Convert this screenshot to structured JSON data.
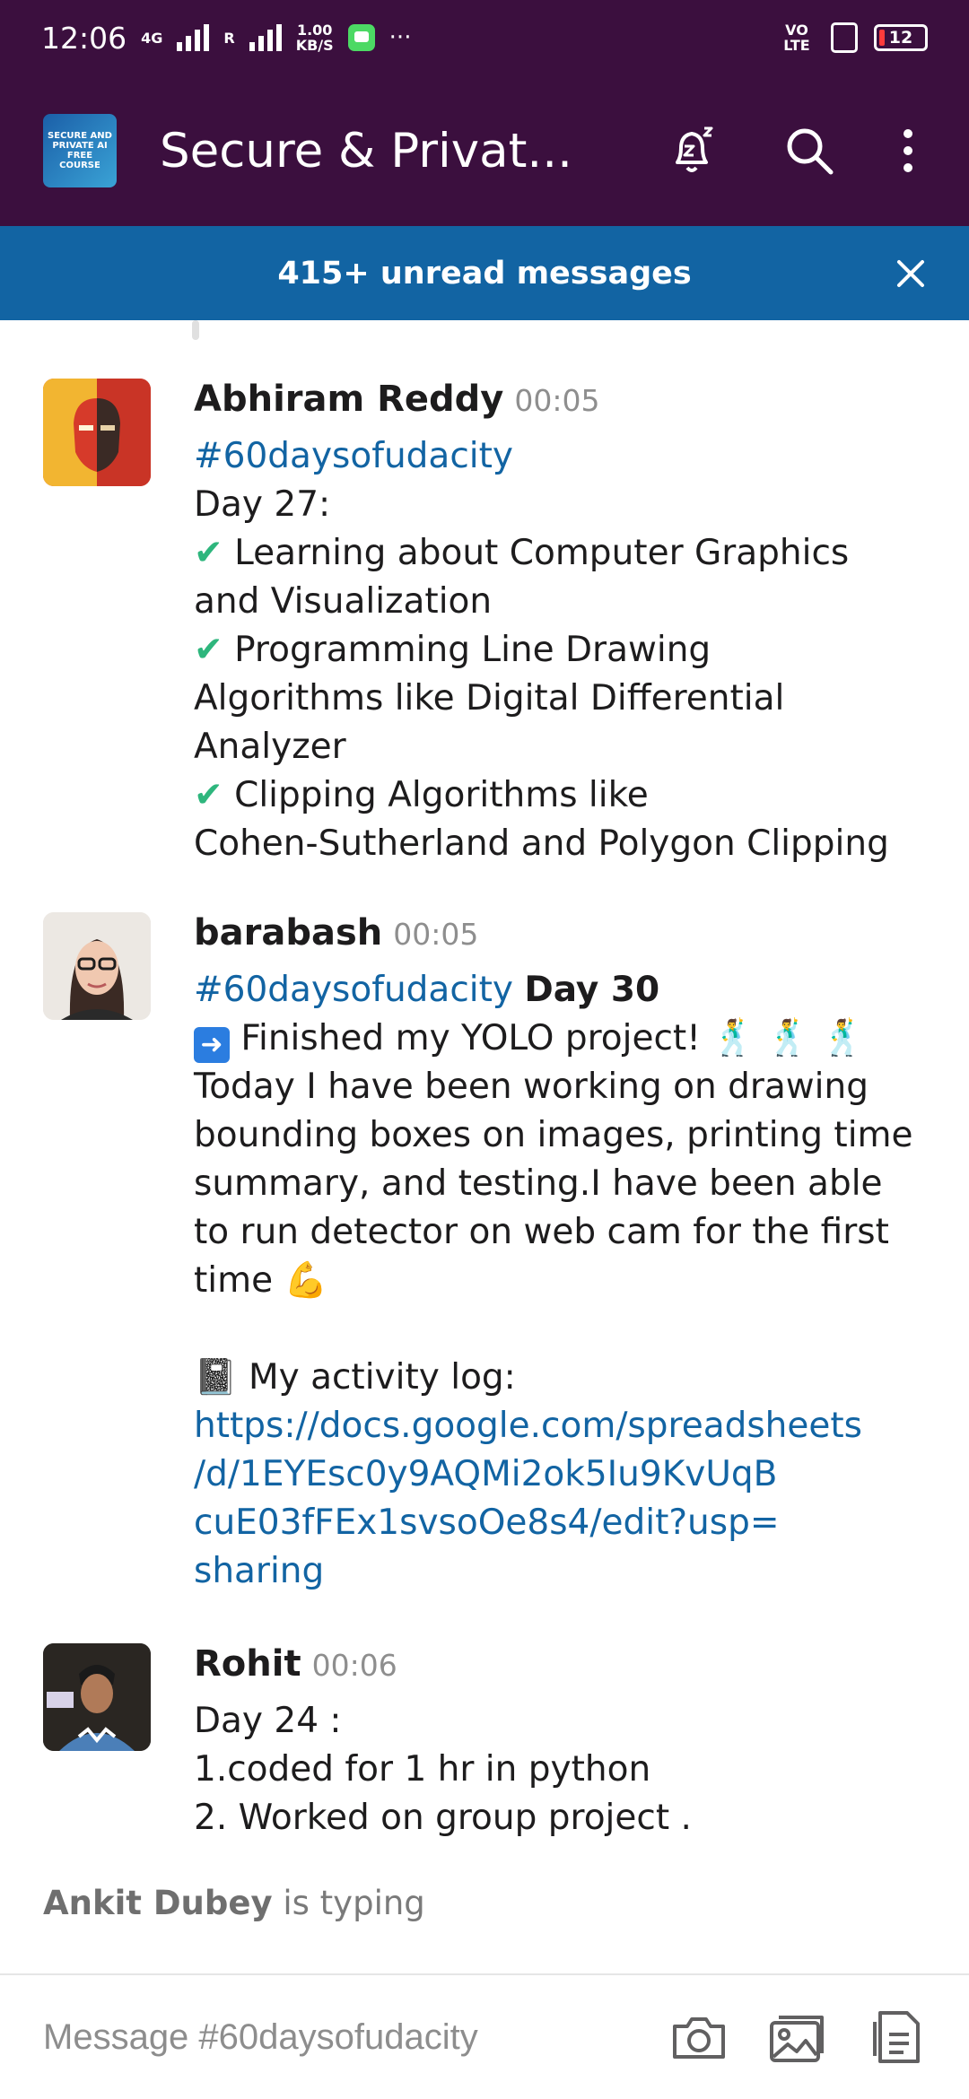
{
  "status_bar": {
    "time": "12:06",
    "net_1": "4G",
    "net_2": "R",
    "speed": "1.00",
    "speed_unit": "KB/S",
    "more": "···",
    "volte": "VO LTE",
    "battery": "12"
  },
  "app_bar": {
    "team_logo_text": "SECURE AND PRIVATE AI FREE COURSE",
    "title": "Secure & Privat...",
    "icons": [
      "snooze-bell-icon",
      "search-icon",
      "more-vert-icon"
    ]
  },
  "banner": {
    "text": "415+ unread messages"
  },
  "messages": [
    {
      "sender": "Abhiram Reddy",
      "time": "00:05",
      "lines": [
        "#60daysofudacity",
        "Day  27:",
        "Learning about Computer Graphics",
        "and Visualization",
        "Programming Line Drawing",
        "Algorithms like  Digital Differential",
        "Analyzer",
        "Clipping Algorithms like",
        "Cohen-Sutherland and Polygon Clipping"
      ]
    },
    {
      "sender": "barabash",
      "time": "00:05",
      "hashtag": "#60daysofudacity",
      "day_label": "Day 30",
      "lines": [
        "Finished my YOLO project! 🕺 🕺 🕺",
        "Today I have been working on drawing",
        "bounding boxes on images, printing time",
        "summary, and testing.I have been able",
        "to run detector on web cam for the first",
        "time 💪",
        "📓 My activity log:"
      ],
      "link_lines": [
        "https://docs.google.com/spreadsheets",
        "/d/1EYEsc0y9AQMi2ok5Iu9KvUqB",
        "cuE03fFEx1svsoOe8s4/edit?usp=",
        "sharing"
      ]
    },
    {
      "sender": "Rohit",
      "time": "00:06",
      "lines": [
        "Day 24 :",
        "1.coded for 1 hr in python",
        "2. Worked on group project ."
      ]
    }
  ],
  "typing": {
    "name": "Ankit Dubey",
    "text": "is typing"
  },
  "composer": {
    "placeholder": "Message #60daysofudacity",
    "icons": [
      "camera-icon",
      "gallery-icon",
      "file-icon"
    ]
  },
  "colors": {
    "app_bar": "#3b0f3e",
    "banner": "#1264a3",
    "link": "#1264a3",
    "check": "#2eb67d"
  }
}
